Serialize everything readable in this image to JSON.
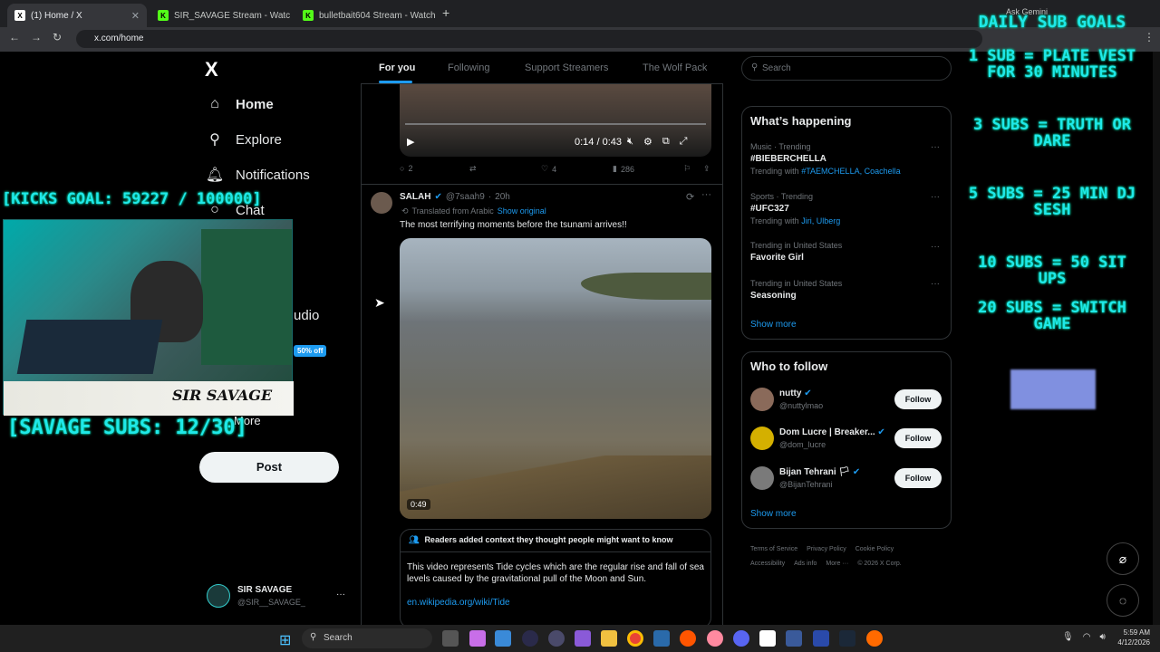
{
  "browser": {
    "tabs": [
      {
        "label": "(1) Home / X",
        "icon": "x-logo-icon"
      },
      {
        "label": "SIR_SAVAGE Stream - Watch Li",
        "icon": "kick-icon"
      },
      {
        "label": "bulletbait604 Stream - Watch L",
        "icon": "kick-icon"
      }
    ],
    "url": "x.com/home",
    "gemini": "Ask Gemini"
  },
  "nav": {
    "logo": "X",
    "items": [
      {
        "label": "Home",
        "icon": "home-icon"
      },
      {
        "label": "Explore",
        "icon": "search-icon"
      },
      {
        "label": "Notifications",
        "icon": "bell-icon"
      },
      {
        "label": "Chat",
        "icon": "chat-icon"
      },
      {
        "label": "s",
        "icon": "list-icon"
      },
      {
        "label": "udio",
        "icon": "mic-icon"
      },
      {
        "label": "More",
        "icon": "more-icon"
      }
    ],
    "badge": "50% off",
    "post": "Post",
    "account": {
      "name": "SIR SAVAGE",
      "handle": "@SIR__SAVAGE_",
      "menu": "···"
    }
  },
  "feed": {
    "tabs": [
      "For you",
      "Following",
      "Support Streamers",
      "The Wolf Pack"
    ],
    "video1": {
      "time": "0:14 / 0:43"
    },
    "actions1": {
      "replies": "2",
      "likes": "4",
      "views": "286"
    },
    "tweet": {
      "name": "SALAH",
      "handle": "@7saah9",
      "age": "20h",
      "translated": "Translated from Arabic",
      "show_original": "Show original",
      "text": "The most terrifying moments before the tsunami arrives!!",
      "duration": "0:49"
    },
    "note": {
      "title": "Readers added context they thought people might want to know",
      "body": "This video represents Tide cycles which are the regular rise and fall of sea levels caused by the gravitational pull of the Moon and Sun.",
      "link": "en.wikipedia.org/wiki/Tide"
    }
  },
  "right": {
    "search_placeholder": "Search",
    "happening_title": "What’s happening",
    "trends": [
      {
        "meta": "Music · Trending",
        "title": "#BIEBERCHELLA",
        "with_prefix": "Trending with",
        "with": "#TAEMCHELLA, Coachella"
      },
      {
        "meta": "Sports · Trending",
        "title": "#UFC327",
        "with_prefix": "Trending with",
        "with": "Jiri, Ulberg"
      },
      {
        "meta": "Trending in United States",
        "title": "Favorite Girl",
        "with_prefix": "",
        "with": ""
      },
      {
        "meta": "Trending in United States",
        "title": "Seasoning",
        "with_prefix": "",
        "with": ""
      }
    ],
    "show_more": "Show more",
    "who_title": "Who to follow",
    "follow": [
      {
        "name": "nutty",
        "handle": "@nuttylmao",
        "button": "Follow"
      },
      {
        "name": "Dom Lucre | Breaker...",
        "handle": "@dom_lucre",
        "button": "Follow"
      },
      {
        "name": "Bijan Tehrani",
        "handle": "@BijanTehrani",
        "button": "Follow"
      }
    ],
    "show_more2": "Show more",
    "footer": [
      "Terms of Service",
      "Privacy Policy",
      "Cookie Policy",
      "Accessibility",
      "Ads info",
      "More ···",
      "© 2026 X Corp."
    ]
  },
  "overlay": {
    "kicks_goal": "[KICKS GOAL: 59227 / 100000]",
    "subs": "[SAVAGE SUBS: 12/30]",
    "cam_label": "SIR SAVAGE",
    "goals_title": "DAILY SUB GOALS",
    "goals": [
      "1 SUB = PLATE VEST FOR 30 MINUTES",
      "3 SUBS = TRUTH OR DARE",
      "5 SUBS = 25 MIN DJ SESH",
      "10 SUBS = 50 SIT UPS",
      "20 SUBS = SWITCH GAME"
    ]
  },
  "taskbar": {
    "search": "Search",
    "time": "5:59 AM",
    "date": "4/12/2026"
  },
  "colors": {
    "accent": "#1d9bf0",
    "neon": "#1fe8e8",
    "bg": "#000000"
  }
}
